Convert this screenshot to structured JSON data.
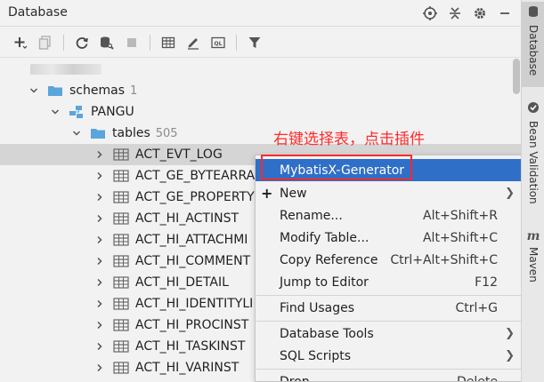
{
  "panel": {
    "title": "Database",
    "title_tools": [
      "crosshair-icon",
      "collapse-icon",
      "gear-icon",
      "minimize-icon"
    ]
  },
  "toolbar": {
    "buttons": [
      "add-icon",
      "duplicate-icon",
      "refresh-icon",
      "schema-settings-icon",
      "stop-icon",
      "table-view-icon",
      "edit-icon",
      "sql-console-icon",
      "filter-icon"
    ]
  },
  "tree": {
    "schemas_label": "schemas",
    "schemas_count": "1",
    "schema_name": "PANGU",
    "tables_label": "tables",
    "tables_count": "505",
    "tables": [
      "ACT_EVT_LOG",
      "ACT_GE_BYTEARRA",
      "ACT_GE_PROPERTY",
      "ACT_HI_ACTINST",
      "ACT_HI_ATTACHMI",
      "ACT_HI_COMMENT",
      "ACT_HI_DETAIL",
      "ACT_HI_IDENTITYLI",
      "ACT_HI_PROCINST",
      "ACT_HI_TASKINST",
      "ACT_HI_VARINST"
    ]
  },
  "annotation": "右键选择表，点击插件",
  "context_menu": {
    "items": [
      {
        "label": "MybatisX-Generator",
        "shortcut": ""
      },
      {
        "label": "New",
        "shortcut": ""
      },
      {
        "label": "Rename...",
        "shortcut": "Alt+Shift+R"
      },
      {
        "label": "Modify Table...",
        "shortcut": "Alt+Shift+C"
      },
      {
        "label": "Copy Reference",
        "shortcut": "Ctrl+Alt+Shift+C"
      },
      {
        "label": "Jump to Editor",
        "shortcut": "F12"
      },
      {
        "label": "Find Usages",
        "shortcut": "Ctrl+G"
      },
      {
        "label": "Database Tools",
        "shortcut": ""
      },
      {
        "label": "SQL Scripts",
        "shortcut": ""
      },
      {
        "label": "Drop",
        "shortcut": "Delete"
      }
    ]
  },
  "side_tabs": {
    "database": "Database",
    "bean_validation": "Bean Validation",
    "maven": "Maven"
  },
  "colors": {
    "highlight": "#2f6fc8",
    "annotation_red": "#ff2a2a",
    "folder_blue": "#5aa5db"
  }
}
